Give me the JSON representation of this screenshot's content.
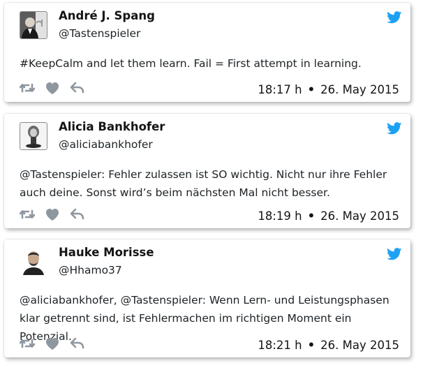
{
  "colors": {
    "twitter_blue": "#1da1f2",
    "action_gray": "#8e979f"
  },
  "tweets": [
    {
      "avatar_icon": "avatar-andre-spang",
      "name": "André J. Spang",
      "handle": "@Tastenspieler",
      "text": "#KeepCalm and let them learn. Fail = First attempt in learning.",
      "time": "18:17 h",
      "separator": "•",
      "date": "26. May 2015"
    },
    {
      "avatar_icon": "avatar-alicia-bankhofer",
      "name": "Alicia Bankhofer",
      "handle": "@aliciabankhofer",
      "text": "@Tastenspieler: Fehler zulassen ist SO wichtig. Nicht nur ihre Fehler auch deine. Sonst wird’s beim nächsten Mal nicht besser.",
      "time": "18:19 h",
      "separator": "•",
      "date": "26. May 2015"
    },
    {
      "avatar_icon": "avatar-hauke-morisse",
      "name": "Hauke Morisse",
      "handle": "@Hhamo37",
      "text": "@aliciabankhofer, @Tastenspieler: Wenn Lern- und Leistungsphasen klar getrennt sind, ist Fehlermachen im richtigen Moment ein Potenzial.",
      "time": "18:21 h",
      "separator": "•",
      "date": "26. May 2015"
    }
  ]
}
